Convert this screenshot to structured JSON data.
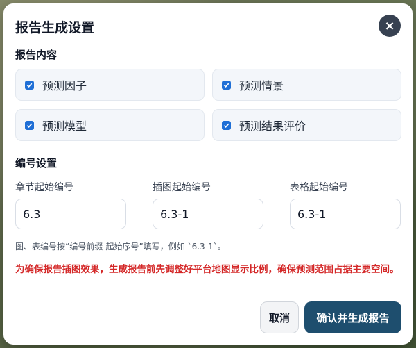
{
  "dialog": {
    "title": "报告生成设置",
    "close_glyph": "×"
  },
  "content_section": {
    "title": "报告内容",
    "options": [
      {
        "label": "预测因子",
        "checked": true
      },
      {
        "label": "预测情景",
        "checked": true
      },
      {
        "label": "预测模型",
        "checked": true
      },
      {
        "label": "预测结果评价",
        "checked": true
      }
    ]
  },
  "numbering_section": {
    "title": "编号设置",
    "fields": [
      {
        "label": "章节起始编号",
        "value": "6.3"
      },
      {
        "label": "插图起始编号",
        "value": "6.3-1"
      },
      {
        "label": "表格起始编号",
        "value": "6.3-1"
      }
    ],
    "hint": "图、表编号按“编号前缀-起始序号”填写，例如 `6.3-1`。"
  },
  "warning": "为确保报告插图效果，生成报告前先调整好平台地图显示比例，确保预测范围占据主要空间。",
  "buttons": {
    "cancel": "取消",
    "confirm": "确认并生成报告"
  },
  "colors": {
    "accent": "#1f6fd6",
    "primary_button": "#1e4e6e",
    "warning": "#d42828"
  }
}
